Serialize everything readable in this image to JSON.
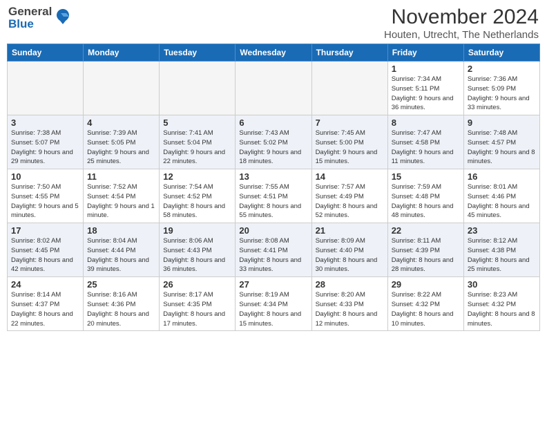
{
  "logo": {
    "general": "General",
    "blue": "Blue"
  },
  "title": "November 2024",
  "subtitle": "Houten, Utrecht, The Netherlands",
  "days_header": [
    "Sunday",
    "Monday",
    "Tuesday",
    "Wednesday",
    "Thursday",
    "Friday",
    "Saturday"
  ],
  "weeks": [
    [
      {
        "day": "",
        "info": ""
      },
      {
        "day": "",
        "info": ""
      },
      {
        "day": "",
        "info": ""
      },
      {
        "day": "",
        "info": ""
      },
      {
        "day": "",
        "info": ""
      },
      {
        "day": "1",
        "info": "Sunrise: 7:34 AM\nSunset: 5:11 PM\nDaylight: 9 hours and 36 minutes."
      },
      {
        "day": "2",
        "info": "Sunrise: 7:36 AM\nSunset: 5:09 PM\nDaylight: 9 hours and 33 minutes."
      }
    ],
    [
      {
        "day": "3",
        "info": "Sunrise: 7:38 AM\nSunset: 5:07 PM\nDaylight: 9 hours and 29 minutes."
      },
      {
        "day": "4",
        "info": "Sunrise: 7:39 AM\nSunset: 5:05 PM\nDaylight: 9 hours and 25 minutes."
      },
      {
        "day": "5",
        "info": "Sunrise: 7:41 AM\nSunset: 5:04 PM\nDaylight: 9 hours and 22 minutes."
      },
      {
        "day": "6",
        "info": "Sunrise: 7:43 AM\nSunset: 5:02 PM\nDaylight: 9 hours and 18 minutes."
      },
      {
        "day": "7",
        "info": "Sunrise: 7:45 AM\nSunset: 5:00 PM\nDaylight: 9 hours and 15 minutes."
      },
      {
        "day": "8",
        "info": "Sunrise: 7:47 AM\nSunset: 4:58 PM\nDaylight: 9 hours and 11 minutes."
      },
      {
        "day": "9",
        "info": "Sunrise: 7:48 AM\nSunset: 4:57 PM\nDaylight: 9 hours and 8 minutes."
      }
    ],
    [
      {
        "day": "10",
        "info": "Sunrise: 7:50 AM\nSunset: 4:55 PM\nDaylight: 9 hours and 5 minutes."
      },
      {
        "day": "11",
        "info": "Sunrise: 7:52 AM\nSunset: 4:54 PM\nDaylight: 9 hours and 1 minute."
      },
      {
        "day": "12",
        "info": "Sunrise: 7:54 AM\nSunset: 4:52 PM\nDaylight: 8 hours and 58 minutes."
      },
      {
        "day": "13",
        "info": "Sunrise: 7:55 AM\nSunset: 4:51 PM\nDaylight: 8 hours and 55 minutes."
      },
      {
        "day": "14",
        "info": "Sunrise: 7:57 AM\nSunset: 4:49 PM\nDaylight: 8 hours and 52 minutes."
      },
      {
        "day": "15",
        "info": "Sunrise: 7:59 AM\nSunset: 4:48 PM\nDaylight: 8 hours and 48 minutes."
      },
      {
        "day": "16",
        "info": "Sunrise: 8:01 AM\nSunset: 4:46 PM\nDaylight: 8 hours and 45 minutes."
      }
    ],
    [
      {
        "day": "17",
        "info": "Sunrise: 8:02 AM\nSunset: 4:45 PM\nDaylight: 8 hours and 42 minutes."
      },
      {
        "day": "18",
        "info": "Sunrise: 8:04 AM\nSunset: 4:44 PM\nDaylight: 8 hours and 39 minutes."
      },
      {
        "day": "19",
        "info": "Sunrise: 8:06 AM\nSunset: 4:43 PM\nDaylight: 8 hours and 36 minutes."
      },
      {
        "day": "20",
        "info": "Sunrise: 8:08 AM\nSunset: 4:41 PM\nDaylight: 8 hours and 33 minutes."
      },
      {
        "day": "21",
        "info": "Sunrise: 8:09 AM\nSunset: 4:40 PM\nDaylight: 8 hours and 30 minutes."
      },
      {
        "day": "22",
        "info": "Sunrise: 8:11 AM\nSunset: 4:39 PM\nDaylight: 8 hours and 28 minutes."
      },
      {
        "day": "23",
        "info": "Sunrise: 8:12 AM\nSunset: 4:38 PM\nDaylight: 8 hours and 25 minutes."
      }
    ],
    [
      {
        "day": "24",
        "info": "Sunrise: 8:14 AM\nSunset: 4:37 PM\nDaylight: 8 hours and 22 minutes."
      },
      {
        "day": "25",
        "info": "Sunrise: 8:16 AM\nSunset: 4:36 PM\nDaylight: 8 hours and 20 minutes."
      },
      {
        "day": "26",
        "info": "Sunrise: 8:17 AM\nSunset: 4:35 PM\nDaylight: 8 hours and 17 minutes."
      },
      {
        "day": "27",
        "info": "Sunrise: 8:19 AM\nSunset: 4:34 PM\nDaylight: 8 hours and 15 minutes."
      },
      {
        "day": "28",
        "info": "Sunrise: 8:20 AM\nSunset: 4:33 PM\nDaylight: 8 hours and 12 minutes."
      },
      {
        "day": "29",
        "info": "Sunrise: 8:22 AM\nSunset: 4:32 PM\nDaylight: 8 hours and 10 minutes."
      },
      {
        "day": "30",
        "info": "Sunrise: 8:23 AM\nSunset: 4:32 PM\nDaylight: 8 hours and 8 minutes."
      }
    ]
  ]
}
